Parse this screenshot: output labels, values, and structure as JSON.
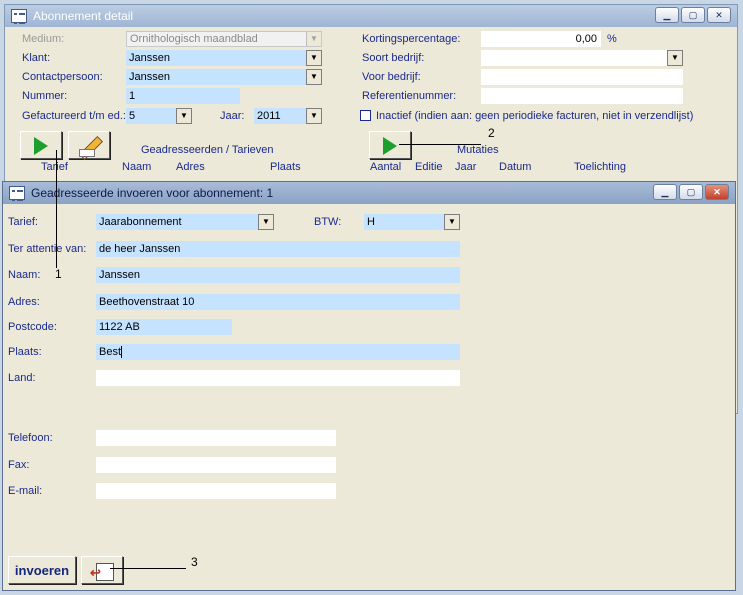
{
  "main_window": {
    "title": "Abonnement detail",
    "fields": {
      "medium": {
        "label": "Medium:",
        "value": "Ornithologisch maandblad"
      },
      "klant": {
        "label": "Klant:",
        "value": "Janssen"
      },
      "contactpersoon": {
        "label": "Contactpersoon:",
        "value": "Janssen"
      },
      "nummer": {
        "label": "Nummer:",
        "value": "1"
      },
      "gefactureerd": {
        "label": "Gefactureerd t/m ed.:",
        "value": "5"
      },
      "jaar": {
        "label": "Jaar:",
        "value": "2011"
      },
      "kortingspercentage": {
        "label": "Kortingspercentage:",
        "value": "0,00",
        "unit": "%"
      },
      "soort_bedrijf": {
        "label": "Soort bedrijf:",
        "value": ""
      },
      "voor_bedrijf": {
        "label": "Voor bedrijf:",
        "value": ""
      },
      "referentienummer": {
        "label": "Referentienummer:",
        "value": ""
      },
      "inactief": {
        "label": "Inactief (indien aan: geen periodieke facturen, niet in verzendlijst)",
        "checked": false
      }
    },
    "section_geadresseerden": {
      "title": "Geadresseerden / Tarieven",
      "columns": [
        "Tarief",
        "Naam",
        "Adres",
        "Plaats"
      ]
    },
    "section_mutaties": {
      "title": "Mutaties",
      "columns": [
        "Aantal",
        "Editie",
        "Jaar",
        "Datum",
        "Toelichting"
      ]
    }
  },
  "sub_window": {
    "title": "Geadresseerde invoeren voor abonnement: 1",
    "fields": {
      "tarief": {
        "label": "Tarief:",
        "value": "Jaarabonnement"
      },
      "btw": {
        "label": "BTW:",
        "value": "H"
      },
      "ter_attentie": {
        "label": "Ter attentie van:",
        "value": "de heer Janssen"
      },
      "naam": {
        "label": "Naam:",
        "value": "Janssen"
      },
      "adres": {
        "label": "Adres:",
        "value": "Beethovenstraat 10"
      },
      "postcode": {
        "label": "Postcode:",
        "value": "1122 AB"
      },
      "plaats": {
        "label": "Plaats:",
        "value": "Best"
      },
      "land": {
        "label": "Land:",
        "value": ""
      },
      "telefoon": {
        "label": "Telefoon:",
        "value": ""
      },
      "fax": {
        "label": "Fax:",
        "value": ""
      },
      "email": {
        "label": "E-mail:",
        "value": ""
      }
    },
    "invoeren_label": "invoeren"
  },
  "callouts": [
    "1",
    "2",
    "3"
  ],
  "colors": {
    "titlebar": "#a8bcd6",
    "subtitlebar": "#8fa8c8",
    "field_blue": "#c5e3ff",
    "label_text": "#1b2a8c"
  }
}
